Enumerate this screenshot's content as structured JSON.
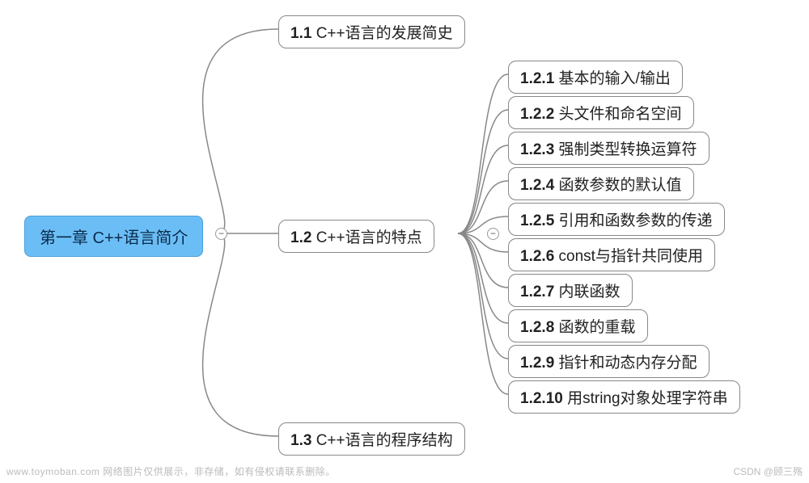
{
  "root": {
    "label": "第一章 C++语言简介"
  },
  "branches": [
    {
      "num": "1.1",
      "label": "C++语言的发展简史"
    },
    {
      "num": "1.2",
      "label": "C++语言的特点"
    },
    {
      "num": "1.3",
      "label": "C++语言的程序结构"
    }
  ],
  "leaves_1_2": [
    {
      "num": "1.2.1",
      "label": "基本的输入/输出"
    },
    {
      "num": "1.2.2",
      "label": "头文件和命名空间"
    },
    {
      "num": "1.2.3",
      "label": "强制类型转换运算符"
    },
    {
      "num": "1.2.4",
      "label": "函数参数的默认值"
    },
    {
      "num": "1.2.5",
      "label": "引用和函数参数的传递"
    },
    {
      "num": "1.2.6",
      "label": "const与指针共同使用"
    },
    {
      "num": "1.2.7",
      "label": "内联函数"
    },
    {
      "num": "1.2.8",
      "label": "函数的重载"
    },
    {
      "num": "1.2.9",
      "label": "指针和动态内存分配"
    },
    {
      "num": "1.2.10",
      "label": "用string对象处理字符串"
    }
  ],
  "collapse_glyph": "−",
  "watermark_left": "www.toymoban.com  网络图片仅供展示，非存储，如有侵权请联系删除。",
  "watermark_right": "CSDN @顾三殇"
}
